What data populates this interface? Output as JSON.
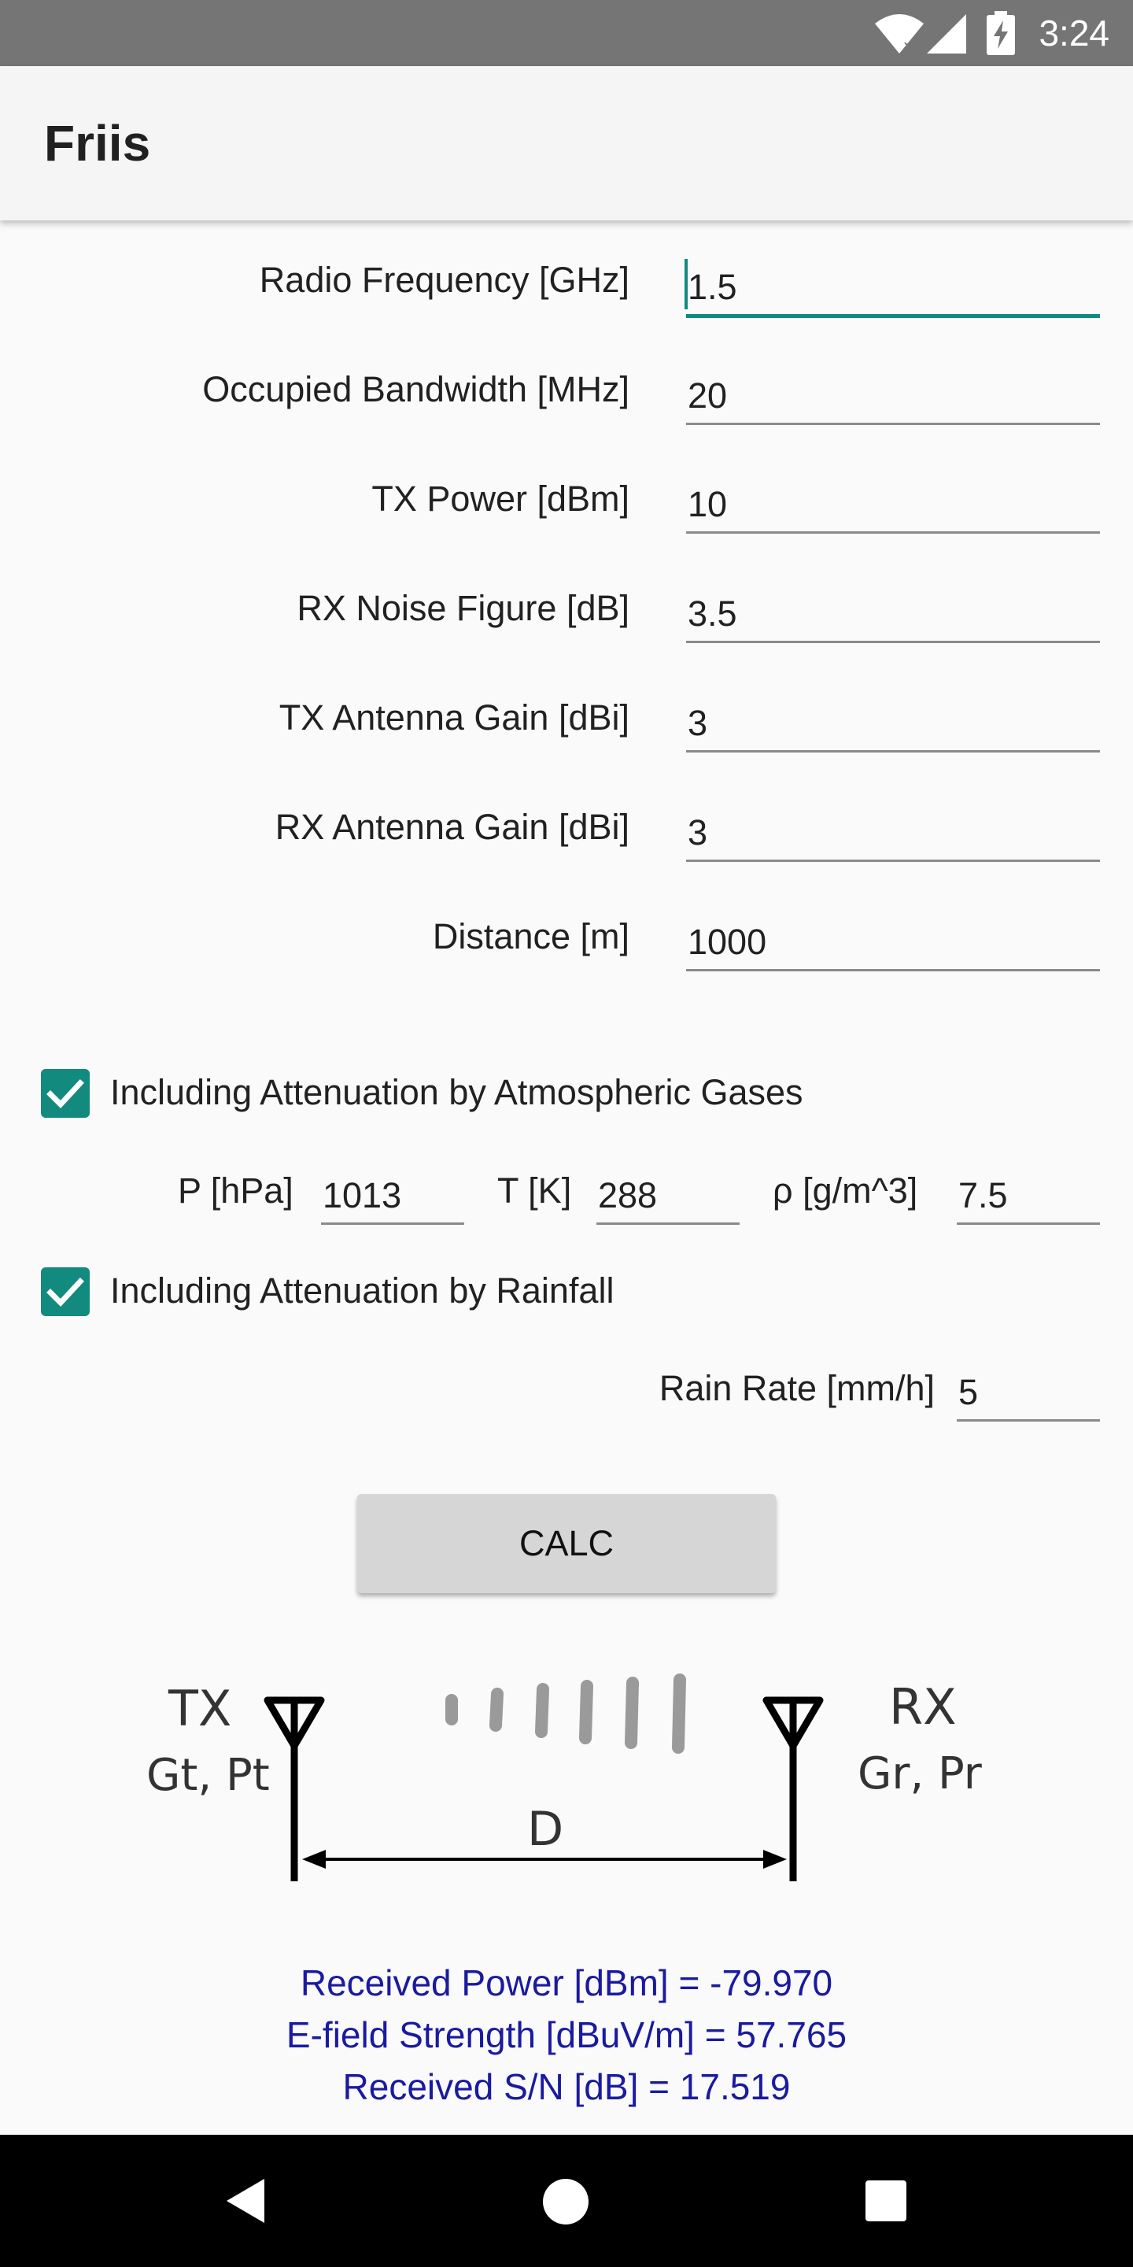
{
  "status_bar": {
    "time": "3:24",
    "icons": [
      "wifi-icon",
      "signal-icon",
      "battery-charging-icon"
    ]
  },
  "app_bar": {
    "title": "Friis"
  },
  "form": {
    "radio_frequency": {
      "label": "Radio Frequency [GHz]",
      "value": "1.5"
    },
    "occupied_bandwidth": {
      "label": "Occupied Bandwidth [MHz]",
      "value": "20"
    },
    "tx_power": {
      "label": "TX Power [dBm]",
      "value": "10"
    },
    "rx_noise_figure": {
      "label": "RX Noise Figure [dB]",
      "value": "3.5"
    },
    "tx_antenna_gain": {
      "label": "TX Antenna Gain [dBi]",
      "value": "3"
    },
    "rx_antenna_gain": {
      "label": "RX Antenna Gain [dBi]",
      "value": "3"
    },
    "distance": {
      "label": "Distance [m]",
      "value": "1000"
    }
  },
  "atmospheric": {
    "checkbox_label": "Including Attenuation by Atmospheric Gases",
    "checked": true,
    "pressure": {
      "label": "P [hPa]",
      "value": "1013"
    },
    "temperature": {
      "label": "T [K]",
      "value": "288"
    },
    "density": {
      "label": "ρ [g/m^3]",
      "value": "7.5"
    }
  },
  "rainfall": {
    "checkbox_label": "Including Attenuation by Rainfall",
    "checked": true,
    "rain_rate": {
      "label": "Rain Rate [mm/h]",
      "value": "5"
    }
  },
  "calc_button": {
    "label": "CALC"
  },
  "diagram": {
    "tx_label": "TX",
    "tx_params": "Gt, Pt",
    "rx_label": "RX",
    "rx_params": "Gr, Pr",
    "distance_label": "D"
  },
  "results": {
    "received_power": "Received Power [dBm] = -79.970",
    "efield_strength": "E-field Strength [dBuV/m] = 57.765",
    "received_sn": "Received S/N [dB] = 17.519"
  },
  "colors": {
    "accent": "#138a7e",
    "result_text": "#1a1aa0",
    "status_bar": "#757575"
  }
}
